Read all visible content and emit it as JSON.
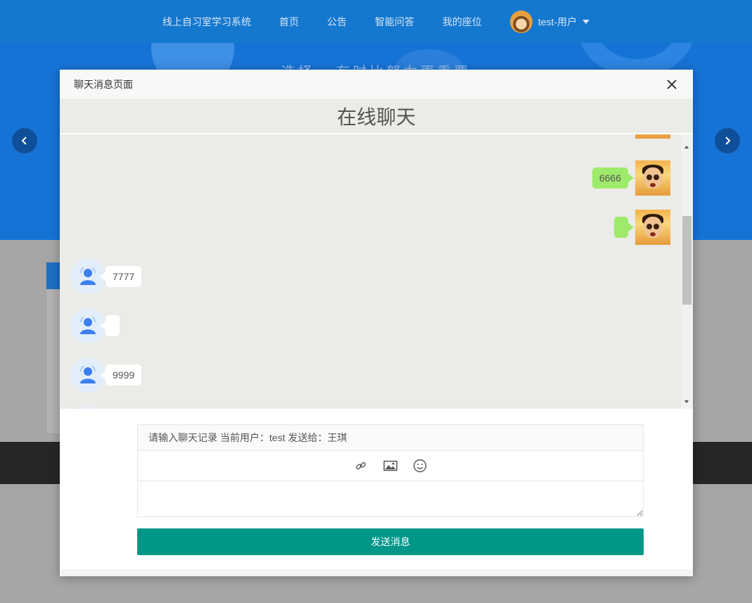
{
  "nav": {
    "items": [
      "线上自习室学习系统",
      "首页",
      "公告",
      "智能问答",
      "我的座位"
    ],
    "user_label": "test-用户"
  },
  "hero": {
    "slogan": "• 选择 · 有时比努力更重要 •"
  },
  "modal": {
    "title": "聊天消息页面",
    "chat_title": "在线聊天"
  },
  "messages": [
    {
      "from": "me",
      "text": "6666"
    },
    {
      "from": "me",
      "text": ""
    },
    {
      "from": "other",
      "text": "7777"
    },
    {
      "from": "other",
      "text": ""
    },
    {
      "from": "other",
      "text": "9999"
    }
  ],
  "compose": {
    "hint": "请输入聊天记录 当前用户：test 发送给：王琪",
    "input_value": "",
    "tools": [
      "link-icon",
      "image-icon",
      "emoji-icon"
    ],
    "send_label": "发送消息"
  },
  "colors": {
    "nav_bg": "#1578cf",
    "hero_bg": "#1673d6",
    "chat_bg": "#ebebe8",
    "bubble_me": "#9eea6a",
    "send_button": "#009688"
  }
}
